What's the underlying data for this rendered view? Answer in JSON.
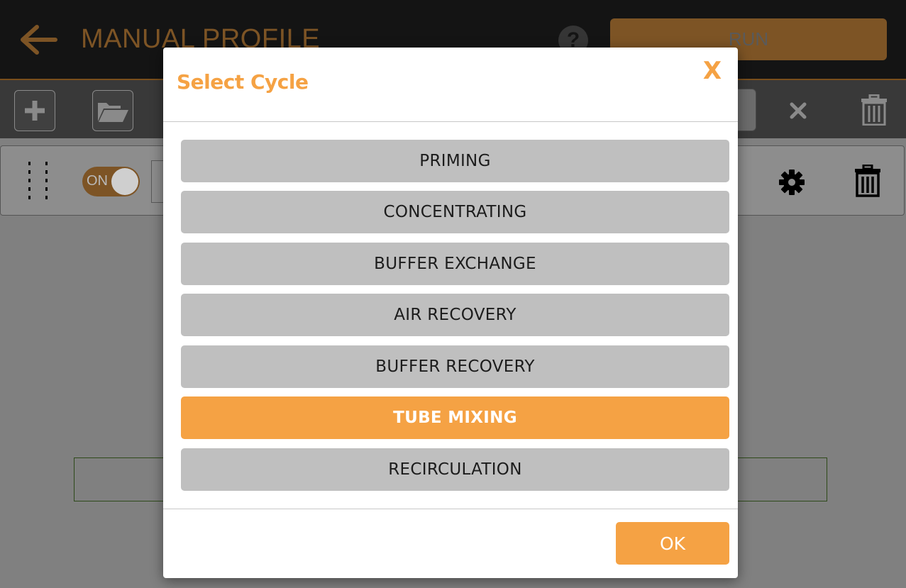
{
  "header": {
    "title": "MANUAL PROFILE",
    "help_label": "?",
    "run_label": "RUN"
  },
  "step": {
    "toggle_label": "ON"
  },
  "dialog": {
    "title": "Select Cycle",
    "close_label": "X",
    "options": [
      {
        "label": "PRIMING",
        "selected": false
      },
      {
        "label": "CONCENTRATING",
        "selected": false
      },
      {
        "label": "BUFFER EXCHANGE",
        "selected": false
      },
      {
        "label": "AIR RECOVERY",
        "selected": false
      },
      {
        "label": "BUFFER RECOVERY",
        "selected": false
      },
      {
        "label": "TUBE MIXING",
        "selected": true
      },
      {
        "label": "RECIRCULATION",
        "selected": false
      }
    ],
    "ok_label": "OK"
  },
  "colors": {
    "accent": "#f5a244",
    "option_bg": "#bfbfbf",
    "overlay": "#808080"
  },
  "icons": {
    "back": "back-arrow-icon",
    "help": "help-icon",
    "add": "plus-icon",
    "open": "folder-open-icon",
    "clear": "close-icon",
    "delete": "trash-icon",
    "drag": "drag-handle-icon",
    "settings": "gear-icon"
  }
}
